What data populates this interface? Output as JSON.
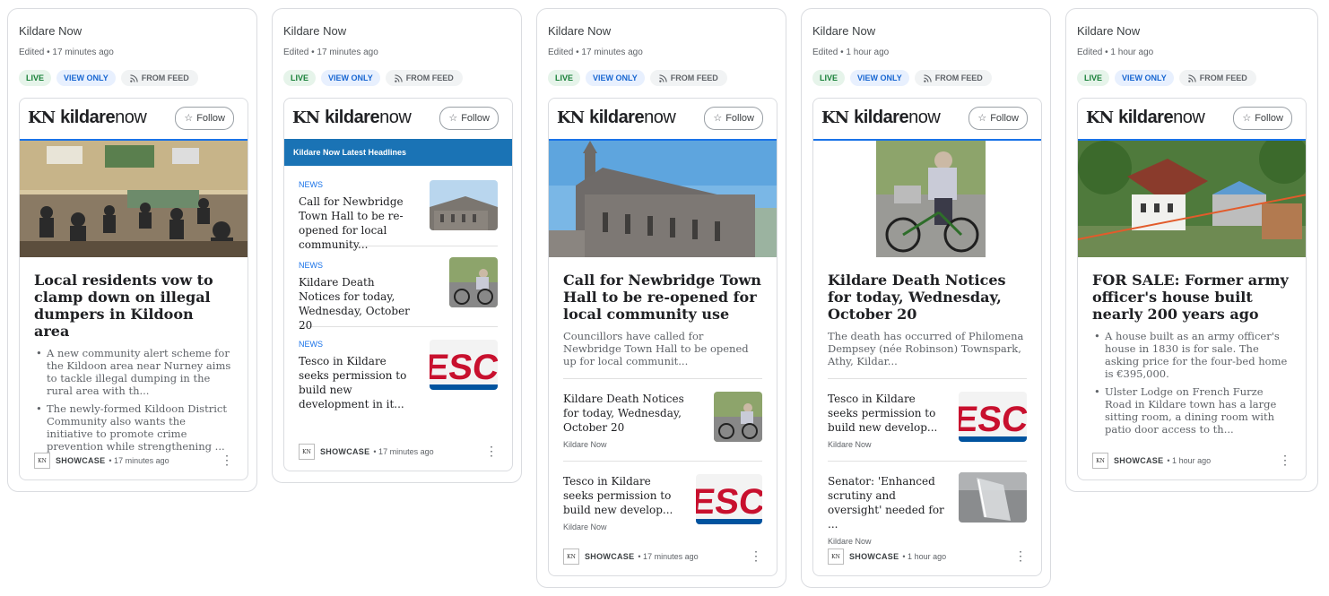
{
  "panels": [
    {
      "title": "Kildare Now",
      "meta": "Edited • 17 minutes ago",
      "chips": {
        "live": "LIVE",
        "view_only": "VIEW ONLY",
        "from_feed": "FROM FEED"
      },
      "card": {
        "brand": {
          "kn": "KN",
          "word_bold": "kildare",
          "word_light": "now"
        },
        "follow": "Follow",
        "headline": "Local residents vow to clamp down on illegal dumpers in Kildoon area",
        "bullets": [
          "A new community alert scheme for the Kildoon area near Nurney aims to tackle illegal dumping in the rural area with th...",
          "The newly-formed Kildoon District Community also wants the initiative to promote crime prevention while strengthening ..."
        ],
        "footer": {
          "source": "SHOWCASE",
          "time": "• 17 minutes ago"
        }
      }
    },
    {
      "title": "Kildare Now",
      "meta": "Edited • 17 minutes ago",
      "chips": {
        "live": "LIVE",
        "view_only": "VIEW ONLY",
        "from_feed": "FROM FEED"
      },
      "card": {
        "brand": {
          "kn": "KN",
          "word_bold": "kildare",
          "word_light": "now"
        },
        "follow": "Follow",
        "list_header": "Kildare Now Latest Headlines",
        "items": [
          {
            "label": "NEWS",
            "title": "Call for Newbridge Town Hall to be re-opened for local community..."
          },
          {
            "label": "NEWS",
            "title": "Kildare Death Notices for today, Wednesday, October 20"
          },
          {
            "label": "NEWS",
            "title": "Tesco in Kildare seeks permission to build new development in it..."
          }
        ],
        "footer": {
          "source": "SHOWCASE",
          "time": "• 17 minutes ago"
        }
      }
    },
    {
      "title": "Kildare Now",
      "meta": "Edited • 17 minutes ago",
      "chips": {
        "live": "LIVE",
        "view_only": "VIEW ONLY",
        "from_feed": "FROM FEED"
      },
      "card": {
        "brand": {
          "kn": "KN",
          "word_bold": "kildare",
          "word_light": "now"
        },
        "follow": "Follow",
        "headline": "Call for Newbridge Town Hall to be re-opened for local community use",
        "desc": "Councillors have called for Newbridge Town Hall to be opened up for local communit...",
        "items": [
          {
            "title": "Kildare Death Notices for today, Wednesday, October 20",
            "source": "Kildare Now"
          },
          {
            "title": "Tesco in Kildare seeks permission to build new develop...",
            "source": "Kildare Now"
          }
        ],
        "footer": {
          "source": "SHOWCASE",
          "time": "• 17 minutes ago"
        }
      }
    },
    {
      "title": "Kildare Now",
      "meta": "Edited • 1 hour ago",
      "chips": {
        "live": "LIVE",
        "view_only": "VIEW ONLY",
        "from_feed": "FROM FEED"
      },
      "card": {
        "brand": {
          "kn": "KN",
          "word_bold": "kildare",
          "word_light": "now"
        },
        "follow": "Follow",
        "headline": "Kildare Death Notices for today, Wednesday, October 20",
        "desc": "The death has occurred of Philomena Dempsey (née Robinson) Townspark, Athy, Kildar...",
        "items": [
          {
            "title": "Tesco in Kildare seeks permission to build new develop...",
            "source": "Kildare Now"
          },
          {
            "title": "Senator: 'Enhanced scrutiny and oversight' needed for ...",
            "source": "Kildare Now"
          }
        ],
        "footer": {
          "source": "SHOWCASE",
          "time": "• 1 hour ago"
        }
      }
    },
    {
      "title": "Kildare Now",
      "meta": "Edited • 1 hour ago",
      "chips": {
        "live": "LIVE",
        "view_only": "VIEW ONLY",
        "from_feed": "FROM FEED"
      },
      "card": {
        "brand": {
          "kn": "KN",
          "word_bold": "kildare",
          "word_light": "now"
        },
        "follow": "Follow",
        "headline": "FOR SALE: Former army officer's house built nearly 200 years ago",
        "bullets": [
          "A house built as an army officer's house in 1830 is for sale.  The asking price for the four-bed home is €395,000.",
          "Ulster Lodge on French Furze Road in Kildare town has a large sitting room, a dining room with patio door access to th..."
        ],
        "footer": {
          "source": "SHOWCASE",
          "time": "• 1 hour ago"
        }
      }
    }
  ],
  "source_icon_text": "KN"
}
